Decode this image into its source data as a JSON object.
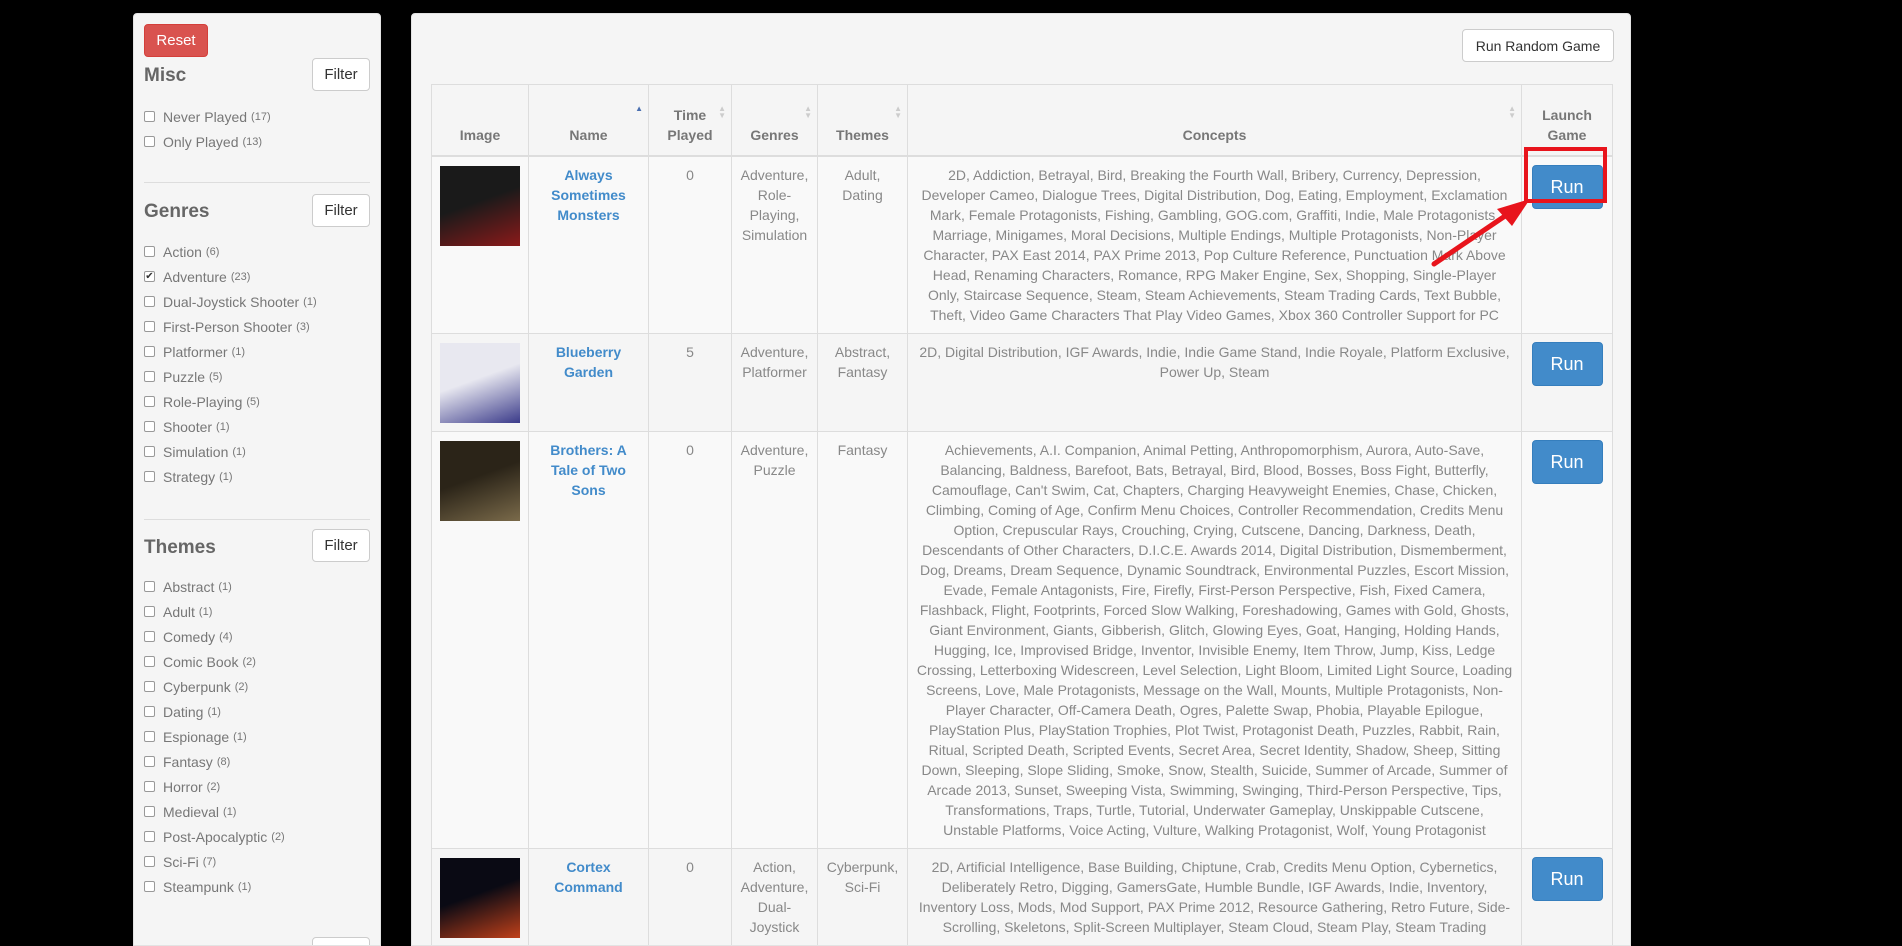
{
  "sidebar": {
    "reset_label": "Reset",
    "filter_label": "Filter",
    "sections": [
      {
        "title": "Misc",
        "items": [
          {
            "label": "Never Played",
            "count": "(17)",
            "checked": false
          },
          {
            "label": "Only Played",
            "count": "(13)",
            "checked": false
          }
        ]
      },
      {
        "title": "Genres",
        "items": [
          {
            "label": "Action",
            "count": "(6)",
            "checked": false
          },
          {
            "label": "Adventure",
            "count": "(23)",
            "checked": true
          },
          {
            "label": "Dual-Joystick Shooter",
            "count": "(1)",
            "checked": false
          },
          {
            "label": "First-Person Shooter",
            "count": "(3)",
            "checked": false
          },
          {
            "label": "Platformer",
            "count": "(1)",
            "checked": false
          },
          {
            "label": "Puzzle",
            "count": "(5)",
            "checked": false
          },
          {
            "label": "Role-Playing",
            "count": "(5)",
            "checked": false
          },
          {
            "label": "Shooter",
            "count": "(1)",
            "checked": false
          },
          {
            "label": "Simulation",
            "count": "(1)",
            "checked": false
          },
          {
            "label": "Strategy",
            "count": "(1)",
            "checked": false
          }
        ]
      },
      {
        "title": "Themes",
        "items": [
          {
            "label": "Abstract",
            "count": "(1)",
            "checked": false
          },
          {
            "label": "Adult",
            "count": "(1)",
            "checked": false
          },
          {
            "label": "Comedy",
            "count": "(4)",
            "checked": false
          },
          {
            "label": "Comic Book",
            "count": "(2)",
            "checked": false
          },
          {
            "label": "Cyberpunk",
            "count": "(2)",
            "checked": false
          },
          {
            "label": "Dating",
            "count": "(1)",
            "checked": false
          },
          {
            "label": "Espionage",
            "count": "(1)",
            "checked": false
          },
          {
            "label": "Fantasy",
            "count": "(8)",
            "checked": false
          },
          {
            "label": "Horror",
            "count": "(2)",
            "checked": false
          },
          {
            "label": "Medieval",
            "count": "(1)",
            "checked": false
          },
          {
            "label": "Post-Apocalyptic",
            "count": "(2)",
            "checked": false
          },
          {
            "label": "Sci-Fi",
            "count": "(7)",
            "checked": false
          },
          {
            "label": "Steampunk",
            "count": "(1)",
            "checked": false
          }
        ]
      }
    ]
  },
  "main": {
    "random_label": "Run Random Game",
    "run_label": "Run",
    "headers": {
      "image": "Image",
      "name": "Name",
      "time": "Time Played",
      "genres": "Genres",
      "themes": "Themes",
      "concepts": "Concepts",
      "launch": "Launch Game"
    },
    "games": [
      {
        "name": "Always Sometimes Monsters",
        "time": "0",
        "genres": "Adventure, Role-Playing, Simulation",
        "themes": "Adult, Dating",
        "concepts": "2D, Addiction, Betrayal, Bird, Breaking the Fourth Wall, Bribery, Currency, Depression, Developer Cameo, Dialogue Trees, Digital Distribution, Dog, Eating, Employment, Exclamation Mark, Female Protagonists, Fishing, Gambling, GOG.com, Graffiti, Indie, Male Protagonists, Marriage, Minigames, Moral Decisions, Multiple Endings, Multiple Protagonists, Non-Player Character, PAX East 2014, PAX Prime 2013, Pop Culture Reference, Punctuation Mark Above Head, Renaming Characters, Romance, RPG Maker Engine, Sex, Shopping, Single-Player Only, Staircase Sequence, Steam, Steam Achievements, Steam Trading Cards, Text Bubble, Theft, Video Game Characters That Play Video Games, Xbox 360 Controller Support for PC",
        "thumb_colors": [
          "#1a1a1a",
          "#8b1a1a"
        ]
      },
      {
        "name": "Blueberry Garden",
        "time": "5",
        "genres": "Adventure, Platformer",
        "themes": "Abstract, Fantasy",
        "concepts": "2D, Digital Distribution, IGF Awards, Indie, Indie Game Stand, Indie Royale, Platform Exclusive, Power Up, Steam",
        "thumb_colors": [
          "#e8e8f0",
          "#3b3b8a"
        ]
      },
      {
        "name": "Brothers: A Tale of Two Sons",
        "time": "0",
        "genres": "Adventure, Puzzle",
        "themes": "Fantasy",
        "concepts": "Achievements, A.I. Companion, Animal Petting, Anthropomorphism, Aurora, Auto-Save, Balancing, Baldness, Barefoot, Bats, Betrayal, Bird, Blood, Bosses, Boss Fight, Butterfly, Camouflage, Can't Swim, Cat, Chapters, Charging Heavyweight Enemies, Chase, Chicken, Climbing, Coming of Age, Confirm Menu Choices, Controller Recommendation, Credits Menu Option, Crepuscular Rays, Crouching, Crying, Cutscene, Dancing, Darkness, Death, Descendants of Other Characters, D.I.C.E. Awards 2014, Digital Distribution, Dismemberment, Dog, Dreams, Dream Sequence, Dynamic Soundtrack, Environmental Puzzles, Escort Mission, Evade, Female Antagonists, Fire, Firefly, First-Person Perspective, Fish, Fixed Camera, Flashback, Flight, Footprints, Forced Slow Walking, Foreshadowing, Games with Gold, Ghosts, Giant Environment, Giants, Gibberish, Glitch, Glowing Eyes, Goat, Hanging, Holding Hands, Hugging, Ice, Improvised Bridge, Inventor, Invisible Enemy, Item Throw, Jump, Kiss, Ledge Crossing, Letterboxing Widescreen, Level Selection, Light Bloom, Limited Light Source, Loading Screens, Love, Male Protagonists, Message on the Wall, Mounts, Multiple Protagonists, Non-Player Character, Off-Camera Death, Ogres, Palette Swap, Phobia, Playable Epilogue, PlayStation Plus, PlayStation Trophies, Plot Twist, Protagonist Death, Puzzles, Rabbit, Rain, Ritual, Scripted Death, Scripted Events, Secret Area, Secret Identity, Shadow, Sheep, Sitting Down, Sleeping, Slope Sliding, Smoke, Snow, Stealth, Suicide, Summer of Arcade, Summer of Arcade 2013, Sunset, Sweeping Vista, Swimming, Swinging, Third-Person Perspective, Tips, Transformations, Traps, Turtle, Tutorial, Underwater Gameplay, Unskippable Cutscene, Unstable Platforms, Voice Acting, Vulture, Walking Protagonist, Wolf, Young Protagonist",
        "thumb_colors": [
          "#2b2418",
          "#7a6a4a"
        ]
      },
      {
        "name": "Cortex Command",
        "time": "0",
        "genres": "Action, Adventure, Dual-Joystick",
        "themes": "Cyberpunk, Sci-Fi",
        "concepts": "2D, Artificial Intelligence, Base Building, Chiptune, Crab, Credits Menu Option, Cybernetics, Deliberately Retro, Digging, GamersGate, Humble Bundle, IGF Awards, Indie, Inventory, Inventory Loss, Mods, Mod Support, PAX Prime 2012, Resource Gathering, Retro Future, Side-Scrolling, Skeletons, Split-Screen Multiplayer, Steam Cloud, Steam Play, Steam Trading",
        "thumb_colors": [
          "#0a0a14",
          "#c0401a"
        ]
      }
    ]
  }
}
